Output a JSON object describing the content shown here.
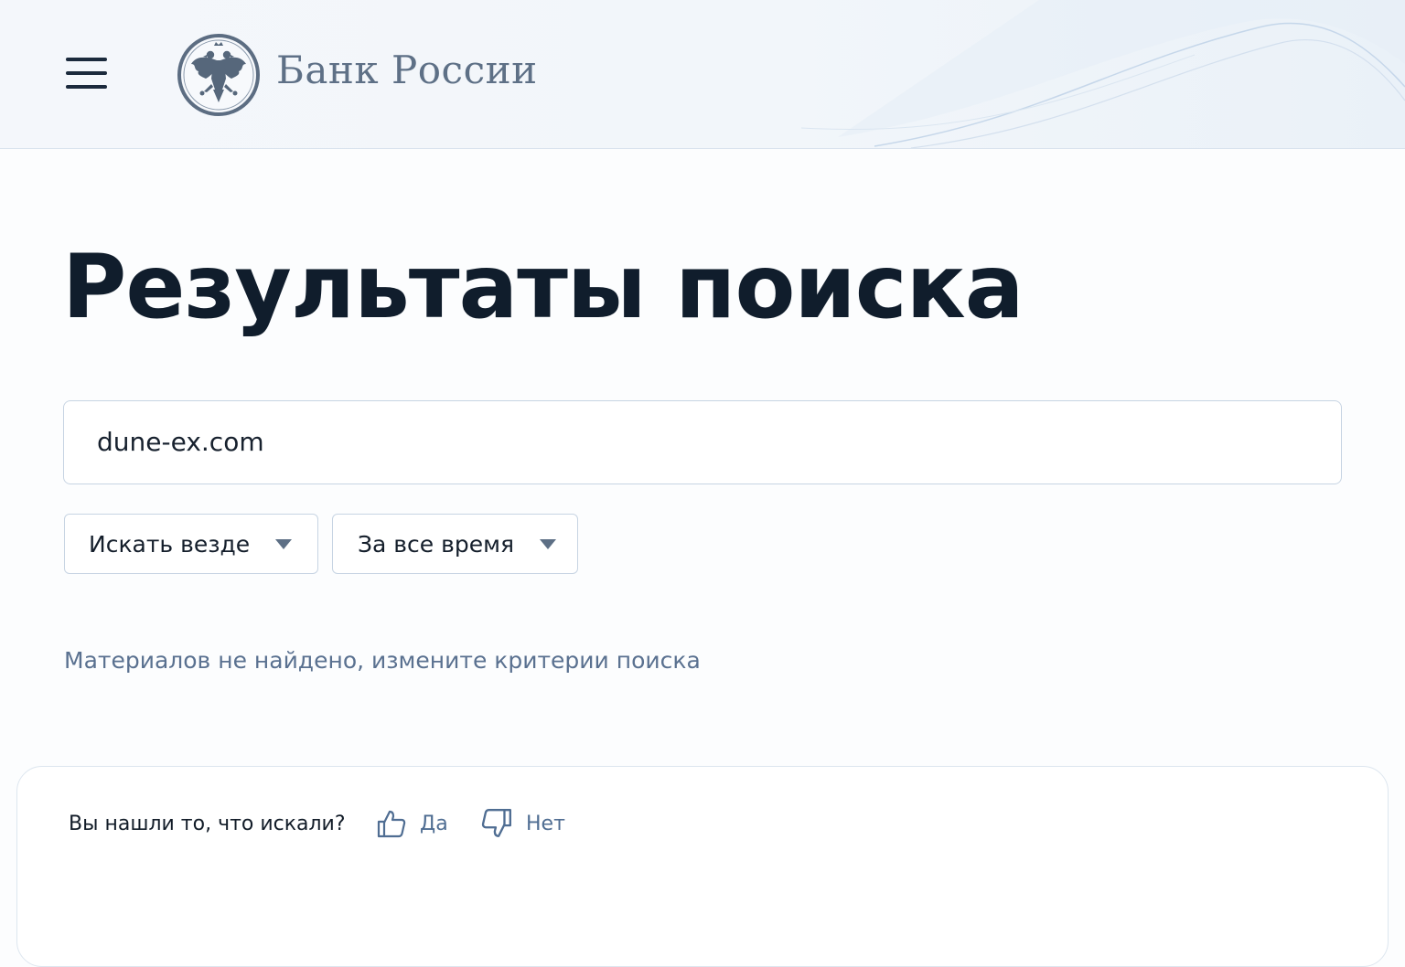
{
  "header": {
    "bank_name": "Банк России",
    "logo_icon": "double-headed-eagle-icon",
    "menu_icon": "hamburger-menu-icon"
  },
  "page": {
    "title": "Результаты поиска"
  },
  "search": {
    "value": "dune-ex.com",
    "placeholder": ""
  },
  "filters": {
    "scope": {
      "selected": "Искать везде"
    },
    "period": {
      "selected": "За все время"
    }
  },
  "results": {
    "empty_message": "Материалов не найдено, измените критерии поиска"
  },
  "feedback": {
    "question": "Вы нашли то, что искали?",
    "yes_label": "Да",
    "no_label": "Нет"
  },
  "colors": {
    "title": "#101d2c",
    "accent_text": "#4f6d92",
    "border": "#c7d4e3",
    "header_bg": "#f2f6fa"
  }
}
